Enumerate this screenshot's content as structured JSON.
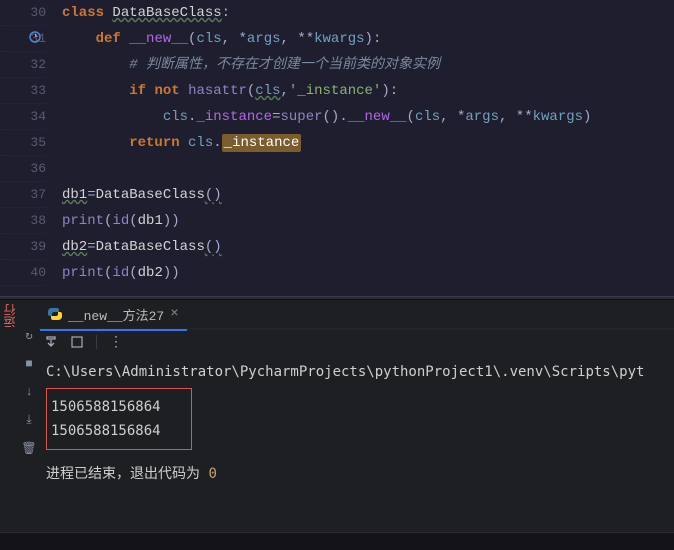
{
  "gutter": {
    "start": 30,
    "lines": [
      30,
      31,
      32,
      33,
      34,
      35,
      36,
      37,
      38,
      39,
      40
    ]
  },
  "code": {
    "l30": {
      "kw_class": "class",
      "cls": "DataBaseClass",
      "colon": ":"
    },
    "l31": {
      "kw_def": "def",
      "name": "__new__",
      "lp": "(",
      "p_cls": "cls",
      "c1": ", ",
      "star1": "*",
      "p_args": "args",
      "c2": ", ",
      "star2": "**",
      "p_kwargs": "kwargs",
      "rp": ")",
      "colon": ":"
    },
    "l32": {
      "comment": "# 判断属性，不存在才创建一个当前类的对象实例"
    },
    "l33": {
      "kw_if": "if",
      "kw_not": "not",
      "fn": "hasattr",
      "lp": "(",
      "p_cls": "cls",
      "comma": ",",
      "str": "'_instance'",
      "rp": ")",
      "colon": ":"
    },
    "l34": {
      "p_cls": "cls",
      "dot": ".",
      "attr": "_instance",
      "eq": "=",
      "sup": "super",
      "par": "()",
      "dot2": ".",
      "new": "__new__",
      "lp": "(",
      "a_cls": "cls",
      "c1": ", ",
      "star1": "*",
      "a_args": "args",
      "c2": ", ",
      "star2": "**",
      "a_kwargs": "kwargs",
      "rp": ")"
    },
    "l35": {
      "kw_return": "return",
      "p_cls": "cls",
      "dot": ".",
      "inst": "_instance"
    },
    "l36": {
      "blank": ""
    },
    "l37": {
      "var": "db1",
      "eq": "=",
      "cls": "DataBaseClass",
      "par": "()"
    },
    "l38": {
      "fn": "print",
      "lp": "(",
      "id": "id",
      "lp2": "(",
      "v": "db1",
      "rp2": ")",
      "rp": ")"
    },
    "l39": {
      "var": "db2",
      "eq": "=",
      "cls": "DataBaseClass",
      "par": "()"
    },
    "l40": {
      "fn": "print",
      "lp": "(",
      "id": "id",
      "lp2": "(",
      "v": "db2",
      "rp2": ")",
      "rp": ")"
    }
  },
  "panel": {
    "left_label": "运行",
    "tab_label": "__new__方法27",
    "toolbar_dots": "⋮"
  },
  "console": {
    "path": "C:\\Users\\Administrator\\PycharmProjects\\pythonProject1\\.venv\\Scripts\\pyt",
    "out1": "1506588156864",
    "out2": "1506588156864",
    "exit_prefix": "进程已结束，退出代码为 ",
    "exit_code": "0"
  }
}
